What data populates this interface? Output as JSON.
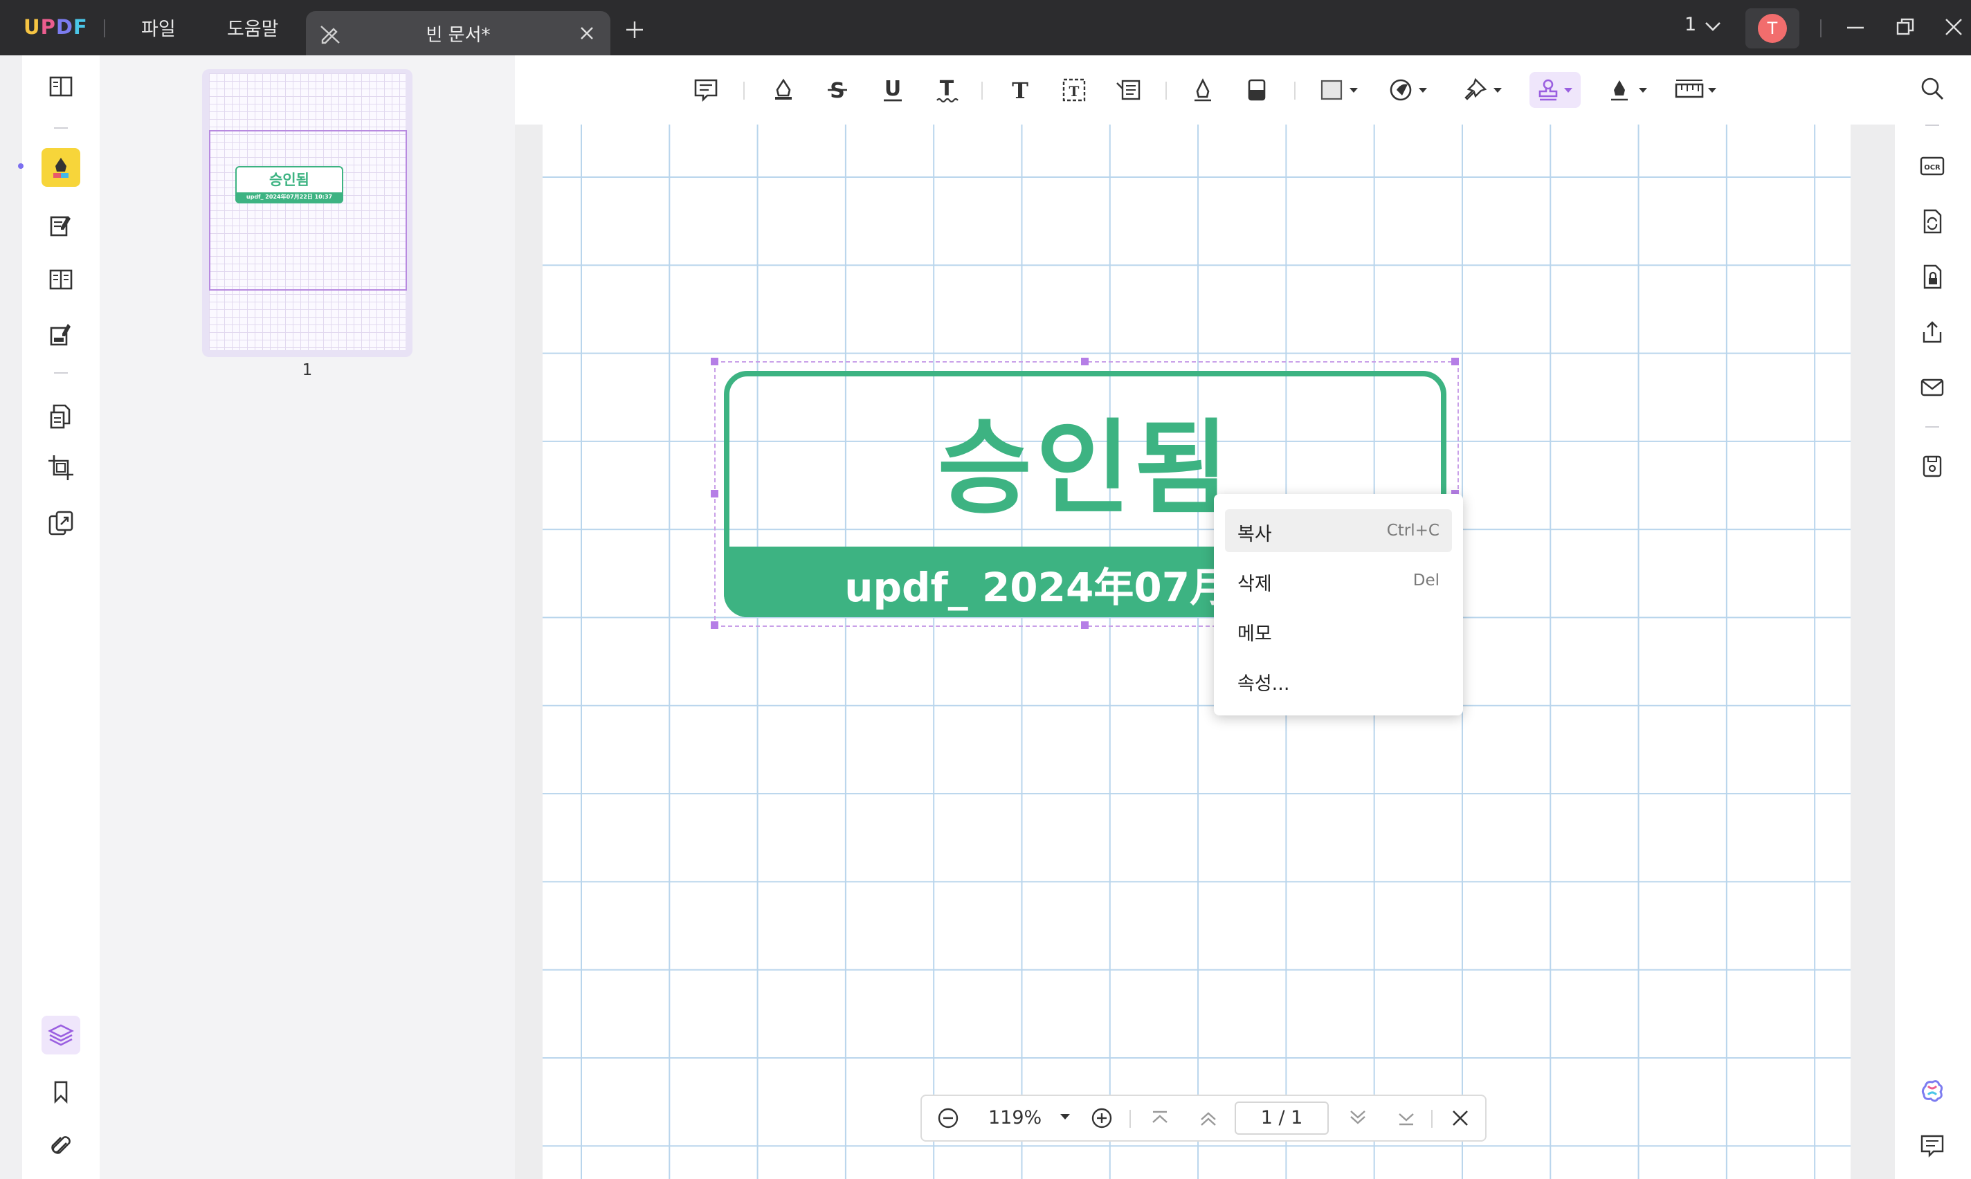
{
  "app": {
    "logo_text": "UPDF",
    "logo_colors": [
      "#f6c443",
      "#ec5d8f",
      "#7c7cf0",
      "#4ac6e8"
    ]
  },
  "menu": {
    "file": "파일",
    "help": "도움말"
  },
  "tab": {
    "title": "빈 문서*"
  },
  "window": {
    "page_count": "1",
    "avatar_letter": "T"
  },
  "thumbnail": {
    "page_number": "1",
    "stamp_title": "승인됨",
    "stamp_date": "updf_ 2024年07月22日 10:37"
  },
  "stamp": {
    "title": "승인됨",
    "date_text": "updf_ 2024年07月22日",
    "color": "#3db382"
  },
  "context_menu": {
    "items": [
      {
        "label": "복사",
        "shortcut": "Ctrl+C"
      },
      {
        "label": "삭제",
        "shortcut": "Del"
      },
      {
        "label": "메모",
        "shortcut": ""
      },
      {
        "label": "속성...",
        "shortcut": ""
      }
    ]
  },
  "zoombar": {
    "zoom": "119%",
    "page_input": "1 / 1"
  },
  "colors": {
    "titlebar": "#2c2c2e",
    "accent_purple": "#b57ee6",
    "grid_line": "#b9d5ec",
    "highlight_tool": "#f7d53a"
  }
}
